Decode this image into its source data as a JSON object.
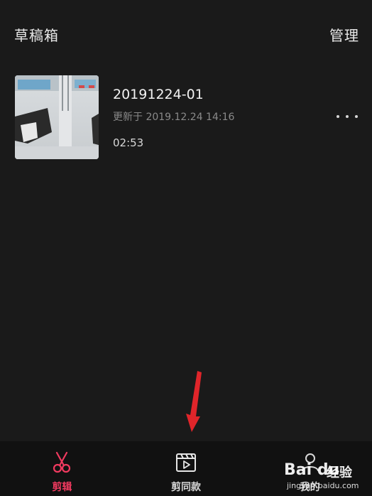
{
  "header": {
    "title": "草稿箱",
    "manage_label": "管理"
  },
  "draft": {
    "name": "20191224-01",
    "updated": "更新于 2019.12.24 14:16",
    "duration": "02:53",
    "more_icon": "more-horizontal-icon"
  },
  "tabs": [
    {
      "label": "剪辑",
      "icon": "scissors-icon",
      "active": true
    },
    {
      "label": "剪同款",
      "icon": "clapperboard-icon",
      "active": false
    },
    {
      "label": "我的",
      "icon": "user-icon",
      "active": false
    }
  ],
  "watermark": {
    "logo": "Bai du",
    "jingyan": "经验",
    "url": "jingyan.baidu.com"
  },
  "colors": {
    "background": "#1a1a1a",
    "tabbar": "#111111",
    "accent": "#f03a5f",
    "arrow": "#e0252a"
  }
}
